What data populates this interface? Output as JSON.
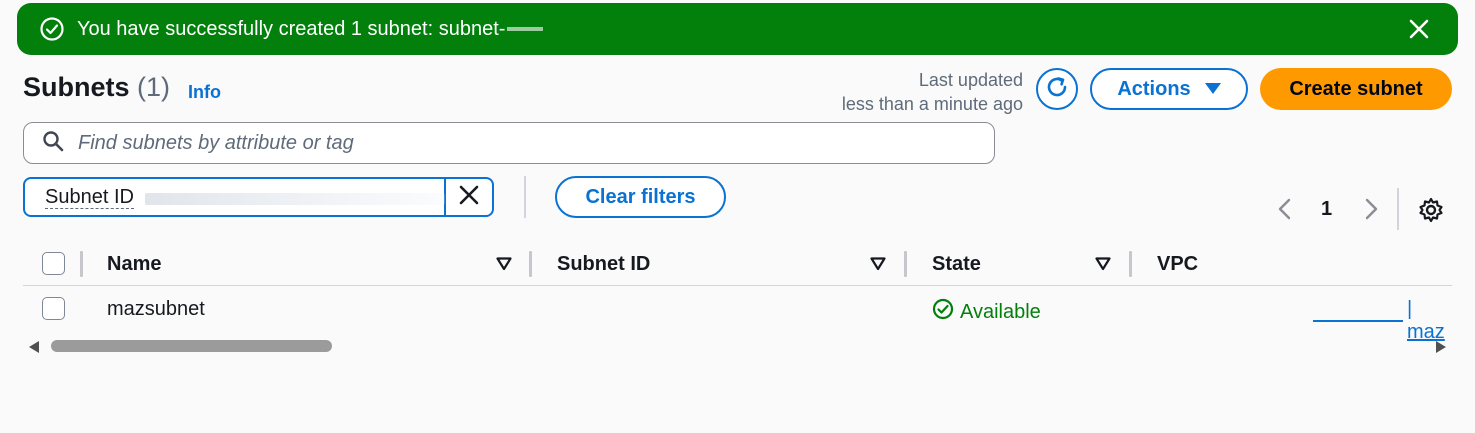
{
  "flash": {
    "message": "You have successfully created 1 subnet: subnet-",
    "status_color": "#037f0c"
  },
  "header": {
    "title": "Subnets",
    "count": "(1)",
    "info_label": "Info",
    "last_updated_line1": "Last updated",
    "last_updated_line2": "less than a minute ago",
    "actions_label": "Actions",
    "create_label": "Create subnet"
  },
  "search": {
    "placeholder": "Find subnets by attribute or tag"
  },
  "filter": {
    "token_label": "Subnet ID",
    "clear_label": "Clear filters"
  },
  "pagination": {
    "current_page": "1"
  },
  "table": {
    "columns": [
      "Name",
      "Subnet ID",
      "State",
      "VPC"
    ],
    "rows": [
      {
        "name": "mazsubnet",
        "subnet_id": "",
        "state": "Available",
        "vpc": "| maz"
      }
    ]
  },
  "colors": {
    "accent": "#0972d3",
    "primary_button": "#ff9900",
    "success": "#037f0c"
  }
}
